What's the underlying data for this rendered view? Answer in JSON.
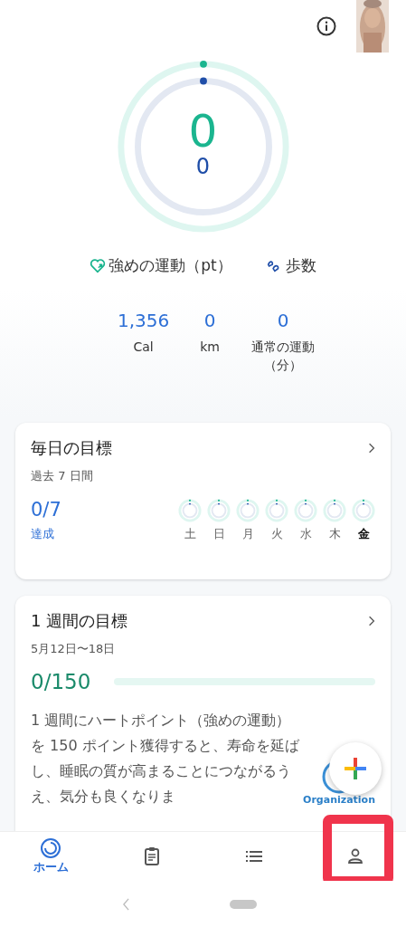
{
  "rings": {
    "heart_points": "0",
    "steps": "0"
  },
  "legend": [
    {
      "kind": "heart",
      "label": "強めの運動（pt）"
    },
    {
      "kind": "steps",
      "label": "歩数"
    }
  ],
  "stats": [
    {
      "value": "1,356",
      "label": "Cal"
    },
    {
      "value": "0",
      "label": "km"
    },
    {
      "value": "0",
      "label": "通常の運動（分）"
    }
  ],
  "daily_goal": {
    "title": "毎日の目標",
    "subtitle": "過去 7 日間",
    "value": "0/7",
    "caption": "達成",
    "days": [
      {
        "label": "土",
        "today": false
      },
      {
        "label": "日",
        "today": false
      },
      {
        "label": "月",
        "today": false
      },
      {
        "label": "火",
        "today": false
      },
      {
        "label": "水",
        "today": false
      },
      {
        "label": "木",
        "today": false
      },
      {
        "label": "金",
        "today": true
      }
    ]
  },
  "weekly_goal": {
    "title": "1 週間の目標",
    "subtitle": "5月12日〜18日",
    "value": "0/150",
    "level": 0,
    "description": "1 週間にハートポイント（強めの運動）を 150 ポイント獲得すると、寿命を延ばし、睡眠の質が高まることにつながるうえ、気分も良くなりま",
    "logo_text": "Organization"
  },
  "bottom_nav": [
    {
      "kind": "home",
      "label": "ホーム",
      "selected": true
    },
    {
      "kind": "journal",
      "selected": false
    },
    {
      "kind": "browse",
      "selected": false
    },
    {
      "kind": "profile",
      "selected": false,
      "highlighted": true
    }
  ]
}
